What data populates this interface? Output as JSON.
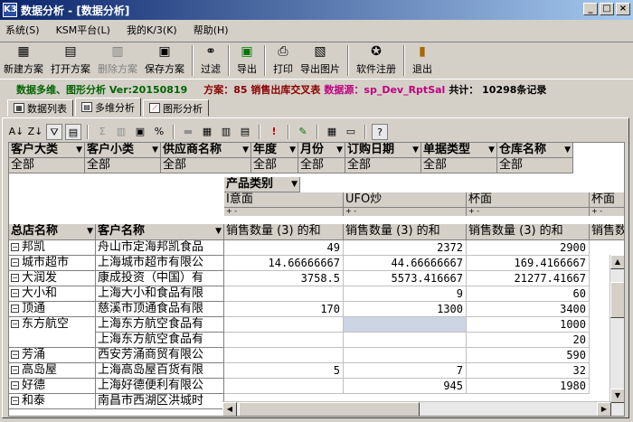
{
  "window": {
    "title": "数据分析 - [数据分析]",
    "app_icon": "K3",
    "min": "_",
    "max": "□",
    "close": "×"
  },
  "menu": [
    "系统(S)",
    "KSM平台(L)",
    "我的K/3(K)",
    "帮助(H)"
  ],
  "toolbar": {
    "new": "新建方案",
    "open": "打开方案",
    "delete": "删除方案",
    "save": "保存方案",
    "filter": "过滤",
    "export": "导出",
    "print": "打印",
    "export_img": "导出图片",
    "register": "软件注册",
    "exit": "退出"
  },
  "info": {
    "title": "数据多维、图形分析 Ver:20150819",
    "plan": "方案：85 销售出库交叉表",
    "source": "数据源：sp_Dev_RptSal",
    "count": "共计： 10298条记录"
  },
  "tabs": [
    "数据列表",
    "多维分析",
    "图形分析"
  ],
  "pivot": {
    "filters": [
      {
        "label": "客户大类",
        "value": "全部"
      },
      {
        "label": "客户小类",
        "value": "全部"
      },
      {
        "label": "供应商名称",
        "value": "全部"
      },
      {
        "label": "年度",
        "value": "全部"
      },
      {
        "label": "月份",
        "value": "全部"
      },
      {
        "label": "订购日期",
        "value": "全部"
      },
      {
        "label": "单据类型",
        "value": "全部"
      },
      {
        "label": "仓库名称",
        "value": "全部"
      }
    ],
    "col_field": "产品类别",
    "row_fields": [
      "总店名称",
      "客户名称"
    ],
    "columns": [
      "I意面",
      "UFO炒",
      "杯面",
      "杯面"
    ],
    "measure": "销售数量 (3) 的和",
    "expand_pm": "+ -",
    "rows": [
      {
        "store": "邦凯",
        "customer": "舟山市定海邦凯食品",
        "v": [
          "49",
          "2372",
          "2900"
        ]
      },
      {
        "store": "城市超市",
        "customer": "上海城市超市有限公",
        "v": [
          "14.66666667",
          "44.66666667",
          "169.4166667"
        ]
      },
      {
        "store": "大润发",
        "customer": "康成投资（中国）有",
        "v": [
          "3758.5",
          "5573.416667",
          "21277.41667"
        ]
      },
      {
        "store": "大小和",
        "customer": "上海大小和食品有限",
        "v": [
          "",
          "9",
          "60"
        ]
      },
      {
        "store": "顶通",
        "customer": "慈溪市顶通食品有限",
        "v": [
          "170",
          "1300",
          "3400"
        ]
      },
      {
        "store": "东方航空",
        "customer": "上海东方航空食品有",
        "v": [
          "",
          "",
          "1000"
        ]
      },
      {
        "store": "",
        "customer": "上海东方航空食品有",
        "v": [
          "",
          "",
          "20"
        ]
      },
      {
        "store": "芳涌",
        "customer": "西安芳涌商贸有限公",
        "v": [
          "",
          "",
          "590"
        ]
      },
      {
        "store": "高岛屋",
        "customer": "上海高岛屋百货有限",
        "v": [
          "5",
          "7",
          "32"
        ]
      },
      {
        "store": "好德",
        "customer": "上海好德便利有限公",
        "v": [
          "",
          "945",
          "1980"
        ]
      },
      {
        "store": "和泰",
        "customer": "南昌市西湖区洪城时",
        "v": [
          "",
          "",
          ""
        ]
      }
    ]
  }
}
